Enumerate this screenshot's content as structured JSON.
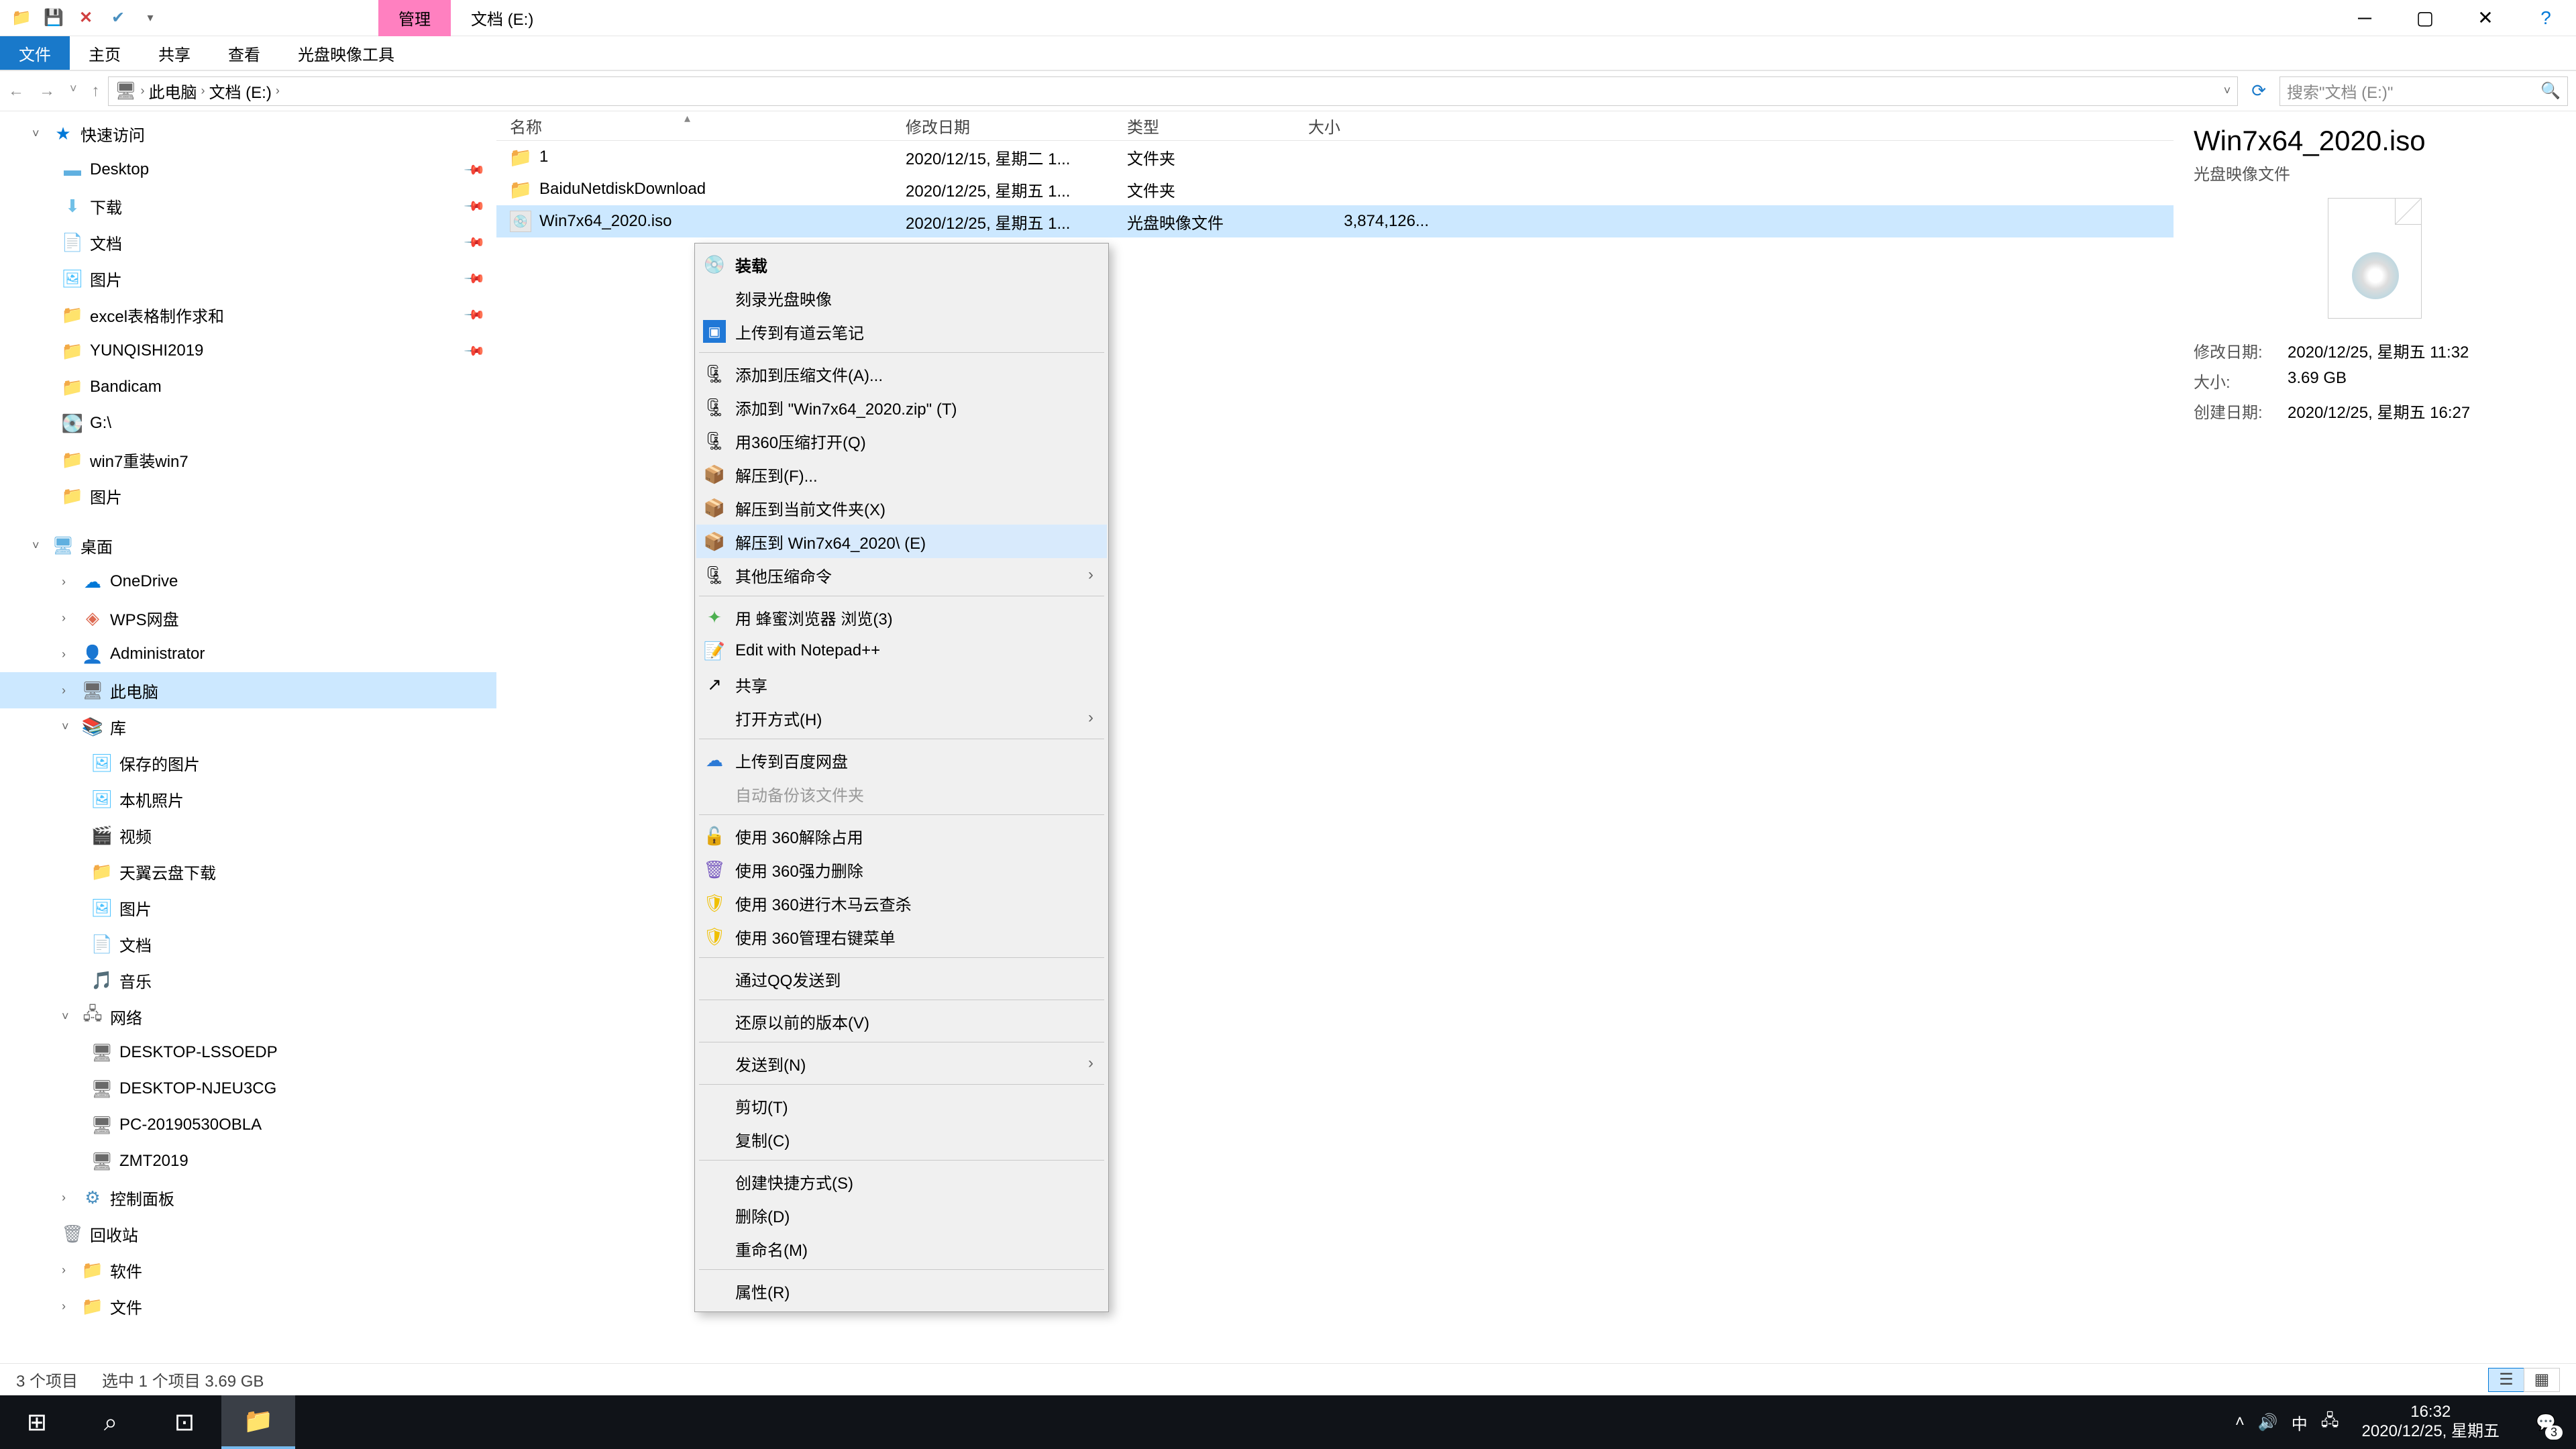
{
  "title_tabs": {
    "manage": "管理",
    "drive": "文档 (E:)"
  },
  "ribbon": {
    "file": "文件",
    "home": "主页",
    "share": "共享",
    "view": "查看",
    "iso_tools": "光盘映像工具"
  },
  "breadcrumb": {
    "this_pc": "此电脑",
    "drive": "文档 (E:)"
  },
  "search_placeholder": "搜索\"文档 (E:)\"",
  "columns": {
    "name": "名称",
    "date": "修改日期",
    "type": "类型",
    "size": "大小"
  },
  "files": [
    {
      "name": "1",
      "date": "2020/12/15, 星期二 1...",
      "type": "文件夹",
      "size": ""
    },
    {
      "name": "BaiduNetdiskDownload",
      "date": "2020/12/25, 星期五 1...",
      "type": "文件夹",
      "size": ""
    },
    {
      "name": "Win7x64_2020.iso",
      "date": "2020/12/25, 星期五 1...",
      "type": "光盘映像文件",
      "size": "3,874,126..."
    }
  ],
  "sidebar": {
    "quick_access": "快速访问",
    "pinned": [
      "Desktop",
      "下载",
      "文档",
      "图片",
      "excel表格制作求和",
      "YUNQISHI2019"
    ],
    "recent": [
      "Bandicam",
      "G:\\",
      "win7重装win7",
      "图片"
    ],
    "desktop_group": "桌面",
    "desktop_items": [
      "OneDrive",
      "WPS网盘",
      "Administrator",
      "此电脑",
      "库"
    ],
    "libraries": [
      "保存的图片",
      "本机照片",
      "视频",
      "天翼云盘下载",
      "图片",
      "文档",
      "音乐"
    ],
    "network": "网络",
    "network_items": [
      "DESKTOP-LSSOEDP",
      "DESKTOP-NJEU3CG",
      "PC-20190530OBLA",
      "ZMT2019"
    ],
    "bottom": [
      "控制面板",
      "回收站",
      "软件",
      "文件"
    ]
  },
  "context_menu": {
    "mount": "装载",
    "burn": "刻录光盘映像",
    "youdao": "上传到有道云笔记",
    "add_archive": "添加到压缩文件(A)...",
    "add_zip": "添加到 \"Win7x64_2020.zip\" (T)",
    "open_360": "用360压缩打开(Q)",
    "extract_to": "解压到(F)...",
    "extract_here": "解压到当前文件夹(X)",
    "extract_named": "解压到 Win7x64_2020\\ (E)",
    "other_compress": "其他压缩命令",
    "browser": "用 蜂蜜浏览器 浏览(3)",
    "notepad": "Edit with Notepad++",
    "share": "共享",
    "open_with": "打开方式(H)",
    "baidu_upload": "上传到百度网盘",
    "auto_backup": "自动备份该文件夹",
    "use360_unlock": "使用 360解除占用",
    "use360_delete": "使用 360强力删除",
    "use360_scan": "使用 360进行木马云查杀",
    "use360_menu": "使用 360管理右键菜单",
    "qq_send": "通过QQ发送到",
    "restore": "还原以前的版本(V)",
    "send_to": "发送到(N)",
    "cut": "剪切(T)",
    "copy": "复制(C)",
    "shortcut": "创建快捷方式(S)",
    "delete": "删除(D)",
    "rename": "重命名(M)",
    "properties": "属性(R)"
  },
  "details": {
    "filename": "Win7x64_2020.iso",
    "filetype": "光盘映像文件",
    "mod_label": "修改日期:",
    "mod_val": "2020/12/25, 星期五 11:32",
    "size_label": "大小:",
    "size_val": "3.69 GB",
    "created_label": "创建日期:",
    "created_val": "2020/12/25, 星期五 16:27"
  },
  "status": {
    "count": "3 个项目",
    "selection": "选中 1 个项目  3.69 GB"
  },
  "taskbar": {
    "time": "16:32",
    "date": "2020/12/25, 星期五",
    "ime": "中",
    "notif_count": "3"
  }
}
